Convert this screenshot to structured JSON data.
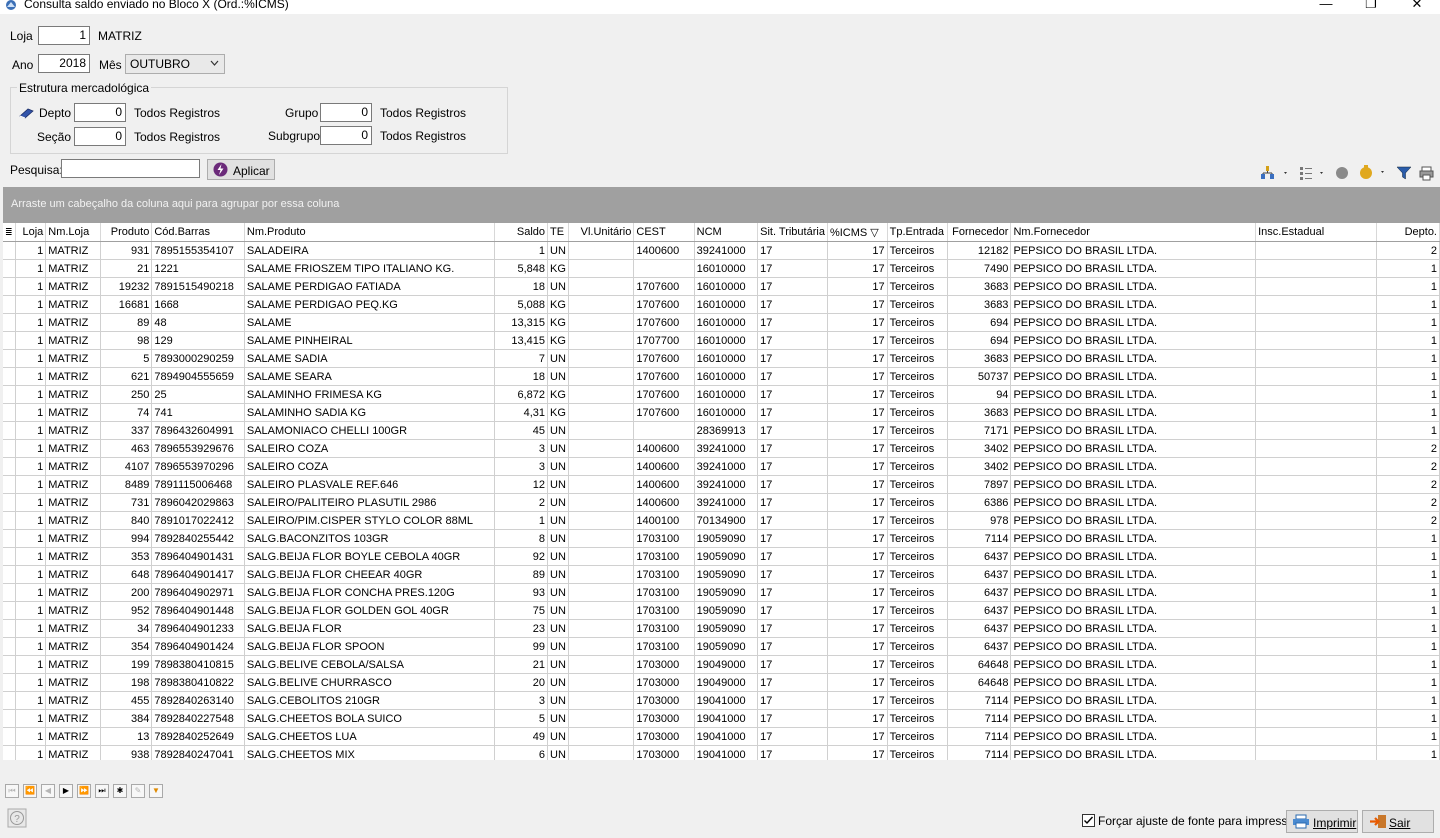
{
  "window": {
    "title": "Consulta saldo enviado no Bloco X (Ord.:%ICMS)",
    "min": "—",
    "max": "❐",
    "close": "✕"
  },
  "form": {
    "loja_label": "Loja",
    "loja_value": "1",
    "loja_name": "MATRIZ",
    "ano_label": "Ano",
    "ano_value": "2018",
    "mes_label": "Mês",
    "mes_value": "OUTUBRO",
    "estrutura_title": "Estrutura mercadológica",
    "depto_label": "Depto",
    "depto_value": "0",
    "depto_desc": "Todos Registros",
    "grupo_label": "Grupo",
    "grupo_value": "0",
    "grupo_desc": "Todos Registros",
    "secao_label": "Seção",
    "secao_value": "0",
    "secao_desc": "Todos Registros",
    "subgrupo_label": "Subgrupo",
    "subgrupo_value": "0",
    "subgrupo_desc": "Todos Registros",
    "pesquisa_label": "Pesquisa:",
    "pesquisa_value": "",
    "aplicar_label": "Aplicar"
  },
  "grid": {
    "group_hint": "Arraste um cabeçalho da coluna aqui para agrupar por essa coluna",
    "columns": [
      "Loja",
      "Nm.Loja",
      "Produto",
      "Cód.Barras",
      "Nm.Produto",
      "Saldo",
      "TE",
      "Vl.Unitário",
      "CEST",
      "NCM",
      "Sit. Tributária",
      "%ICMS",
      "Tp.Entrada",
      "Fornecedor",
      "Nm.Fornecedor",
      "Insc.Estadual",
      "Depto."
    ],
    "rows": [
      [
        "1",
        "MATRIZ",
        "931",
        "7895155354107",
        "SALADEIRA",
        "1",
        "UN",
        "",
        "1400600",
        "39241000",
        "17",
        "17",
        "Terceiros",
        "12182",
        "PEPSICO DO BRASIL LTDA.",
        "",
        "2"
      ],
      [
        "1",
        "MATRIZ",
        "21",
        "1221",
        "SALAME FRIOSZEM TIPO ITALIANO KG.",
        "5,848",
        "KG",
        "",
        "",
        "16010000",
        "17",
        "17",
        "Terceiros",
        "7490",
        "PEPSICO DO BRASIL LTDA.",
        "",
        "1"
      ],
      [
        "1",
        "MATRIZ",
        "19232",
        "7891515490218",
        "SALAME PERDIGAO FATIADA",
        "18",
        "UN",
        "",
        "1707600",
        "16010000",
        "17",
        "17",
        "Terceiros",
        "3683",
        "PEPSICO DO BRASIL LTDA.",
        "",
        "1"
      ],
      [
        "1",
        "MATRIZ",
        "16681",
        "1668",
        "SALAME PERDIGAO PEQ.KG",
        "5,088",
        "KG",
        "",
        "1707600",
        "16010000",
        "17",
        "17",
        "Terceiros",
        "3683",
        "PEPSICO DO BRASIL LTDA.",
        "",
        "1"
      ],
      [
        "1",
        "MATRIZ",
        "89",
        "48",
        "SALAME",
        "13,315",
        "KG",
        "",
        "1707600",
        "16010000",
        "17",
        "17",
        "Terceiros",
        "694",
        "PEPSICO DO BRASIL LTDA.",
        "",
        "1"
      ],
      [
        "1",
        "MATRIZ",
        "98",
        "129",
        "SALAME PINHEIRAL",
        "13,415",
        "KG",
        "",
        "1707700",
        "16010000",
        "17",
        "17",
        "Terceiros",
        "694",
        "PEPSICO DO BRASIL LTDA.",
        "",
        "1"
      ],
      [
        "1",
        "MATRIZ",
        "5",
        "7893000290259",
        "SALAME SADIA",
        "7",
        "UN",
        "",
        "1707600",
        "16010000",
        "17",
        "17",
        "Terceiros",
        "3683",
        "PEPSICO DO BRASIL LTDA.",
        "",
        "1"
      ],
      [
        "1",
        "MATRIZ",
        "621",
        "7894904555659",
        "SALAME SEARA",
        "18",
        "UN",
        "",
        "1707600",
        "16010000",
        "17",
        "17",
        "Terceiros",
        "50737",
        "PEPSICO DO BRASIL LTDA.",
        "",
        "1"
      ],
      [
        "1",
        "MATRIZ",
        "250",
        "25",
        "SALAMINHO FRIMESA KG",
        "6,872",
        "KG",
        "",
        "1707600",
        "16010000",
        "17",
        "17",
        "Terceiros",
        "94",
        "PEPSICO DO BRASIL LTDA.",
        "",
        "1"
      ],
      [
        "1",
        "MATRIZ",
        "74",
        "741",
        "SALAMINHO SADIA KG",
        "4,31",
        "KG",
        "",
        "1707600",
        "16010000",
        "17",
        "17",
        "Terceiros",
        "3683",
        "PEPSICO DO BRASIL LTDA.",
        "",
        "1"
      ],
      [
        "1",
        "MATRIZ",
        "337",
        "7896432604991",
        "SALAMONIACO CHELLI 100GR",
        "45",
        "UN",
        "",
        "",
        "28369913",
        "17",
        "17",
        "Terceiros",
        "7171",
        "PEPSICO DO BRASIL LTDA.",
        "",
        "1"
      ],
      [
        "1",
        "MATRIZ",
        "463",
        "7896553929676",
        "SALEIRO COZA",
        "3",
        "UN",
        "",
        "1400600",
        "39241000",
        "17",
        "17",
        "Terceiros",
        "3402",
        "PEPSICO DO BRASIL LTDA.",
        "",
        "2"
      ],
      [
        "1",
        "MATRIZ",
        "4107",
        "7896553970296",
        "SALEIRO COZA",
        "3",
        "UN",
        "",
        "1400600",
        "39241000",
        "17",
        "17",
        "Terceiros",
        "3402",
        "PEPSICO DO BRASIL LTDA.",
        "",
        "2"
      ],
      [
        "1",
        "MATRIZ",
        "8489",
        "7891115006468",
        "SALEIRO PLASVALE REF.646",
        "12",
        "UN",
        "",
        "1400600",
        "39241000",
        "17",
        "17",
        "Terceiros",
        "7897",
        "PEPSICO DO BRASIL LTDA.",
        "",
        "2"
      ],
      [
        "1",
        "MATRIZ",
        "731",
        "7896042029863",
        "SALEIRO/PALITEIRO PLASUTIL 2986",
        "2",
        "UN",
        "",
        "1400600",
        "39241000",
        "17",
        "17",
        "Terceiros",
        "6386",
        "PEPSICO DO BRASIL LTDA.",
        "",
        "2"
      ],
      [
        "1",
        "MATRIZ",
        "840",
        "7891017022412",
        "SALEIRO/PIM.CISPER STYLO COLOR 88ML",
        "1",
        "UN",
        "",
        "1400100",
        "70134900",
        "17",
        "17",
        "Terceiros",
        "978",
        "PEPSICO DO BRASIL LTDA.",
        "",
        "2"
      ],
      [
        "1",
        "MATRIZ",
        "994",
        "7892840255442",
        "SALG.BACONZITOS 103GR",
        "8",
        "UN",
        "",
        "1703100",
        "19059090",
        "17",
        "17",
        "Terceiros",
        "7114",
        "PEPSICO DO BRASIL LTDA.",
        "",
        "1"
      ],
      [
        "1",
        "MATRIZ",
        "353",
        "7896404901431",
        "SALG.BEIJA FLOR BOYLE CEBOLA 40GR",
        "92",
        "UN",
        "",
        "1703100",
        "19059090",
        "17",
        "17",
        "Terceiros",
        "6437",
        "PEPSICO DO BRASIL LTDA.",
        "",
        "1"
      ],
      [
        "1",
        "MATRIZ",
        "648",
        "7896404901417",
        "SALG.BEIJA FLOR CHEEAR 40GR",
        "89",
        "UN",
        "",
        "1703100",
        "19059090",
        "17",
        "17",
        "Terceiros",
        "6437",
        "PEPSICO DO BRASIL LTDA.",
        "",
        "1"
      ],
      [
        "1",
        "MATRIZ",
        "200",
        "7896404902971",
        "SALG.BEIJA FLOR CONCHA PRES.120G",
        "93",
        "UN",
        "",
        "1703100",
        "19059090",
        "17",
        "17",
        "Terceiros",
        "6437",
        "PEPSICO DO BRASIL LTDA.",
        "",
        "1"
      ],
      [
        "1",
        "MATRIZ",
        "952",
        "7896404901448",
        "SALG.BEIJA FLOR GOLDEN GOL 40GR",
        "75",
        "UN",
        "",
        "1703100",
        "19059090",
        "17",
        "17",
        "Terceiros",
        "6437",
        "PEPSICO DO BRASIL LTDA.",
        "",
        "1"
      ],
      [
        "1",
        "MATRIZ",
        "34",
        "7896404901233",
        "SALG.BEIJA FLOR",
        "23",
        "UN",
        "",
        "1703100",
        "19059090",
        "17",
        "17",
        "Terceiros",
        "6437",
        "PEPSICO DO BRASIL LTDA.",
        "",
        "1"
      ],
      [
        "1",
        "MATRIZ",
        "354",
        "7896404901424",
        "SALG.BEIJA FLOR SPOON",
        "99",
        "UN",
        "",
        "1703100",
        "19059090",
        "17",
        "17",
        "Terceiros",
        "6437",
        "PEPSICO DO BRASIL LTDA.",
        "",
        "1"
      ],
      [
        "1",
        "MATRIZ",
        "199",
        "7898380410815",
        "SALG.BELIVE CEBOLA/SALSA",
        "21",
        "UN",
        "",
        "1703000",
        "19049000",
        "17",
        "17",
        "Terceiros",
        "64648",
        "PEPSICO DO BRASIL LTDA.",
        "",
        "1"
      ],
      [
        "1",
        "MATRIZ",
        "198",
        "7898380410822",
        "SALG.BELIVE CHURRASCO",
        "20",
        "UN",
        "",
        "1703000",
        "19049000",
        "17",
        "17",
        "Terceiros",
        "64648",
        "PEPSICO DO BRASIL LTDA.",
        "",
        "1"
      ],
      [
        "1",
        "MATRIZ",
        "455",
        "7892840263140",
        "SALG.CEBOLITOS 210GR",
        "3",
        "UN",
        "",
        "1703000",
        "19041000",
        "17",
        "17",
        "Terceiros",
        "7114",
        "PEPSICO DO BRASIL LTDA.",
        "",
        "1"
      ],
      [
        "1",
        "MATRIZ",
        "384",
        "7892840227548",
        "SALG.CHEETOS BOLA SUICO",
        "5",
        "UN",
        "",
        "1703000",
        "19041000",
        "17",
        "17",
        "Terceiros",
        "7114",
        "PEPSICO DO BRASIL LTDA.",
        "",
        "1"
      ],
      [
        "1",
        "MATRIZ",
        "13",
        "7892840252649",
        "SALG.CHEETOS LUA",
        "49",
        "UN",
        "",
        "1703000",
        "19041000",
        "17",
        "17",
        "Terceiros",
        "7114",
        "PEPSICO DO BRASIL LTDA.",
        "",
        "1"
      ],
      [
        "1",
        "MATRIZ",
        "938",
        "7892840247041",
        "SALG.CHEETOS MIX",
        "6",
        "UN",
        "",
        "1703000",
        "19041000",
        "17",
        "17",
        "Terceiros",
        "7114",
        "PEPSICO DO BRASIL LTDA.",
        "",
        "1"
      ]
    ]
  },
  "footer": {
    "forcar_label": "Forçar ajuste de fonte para impressão",
    "imprimir_label": "Imprimir",
    "sair_label": "Sair"
  }
}
